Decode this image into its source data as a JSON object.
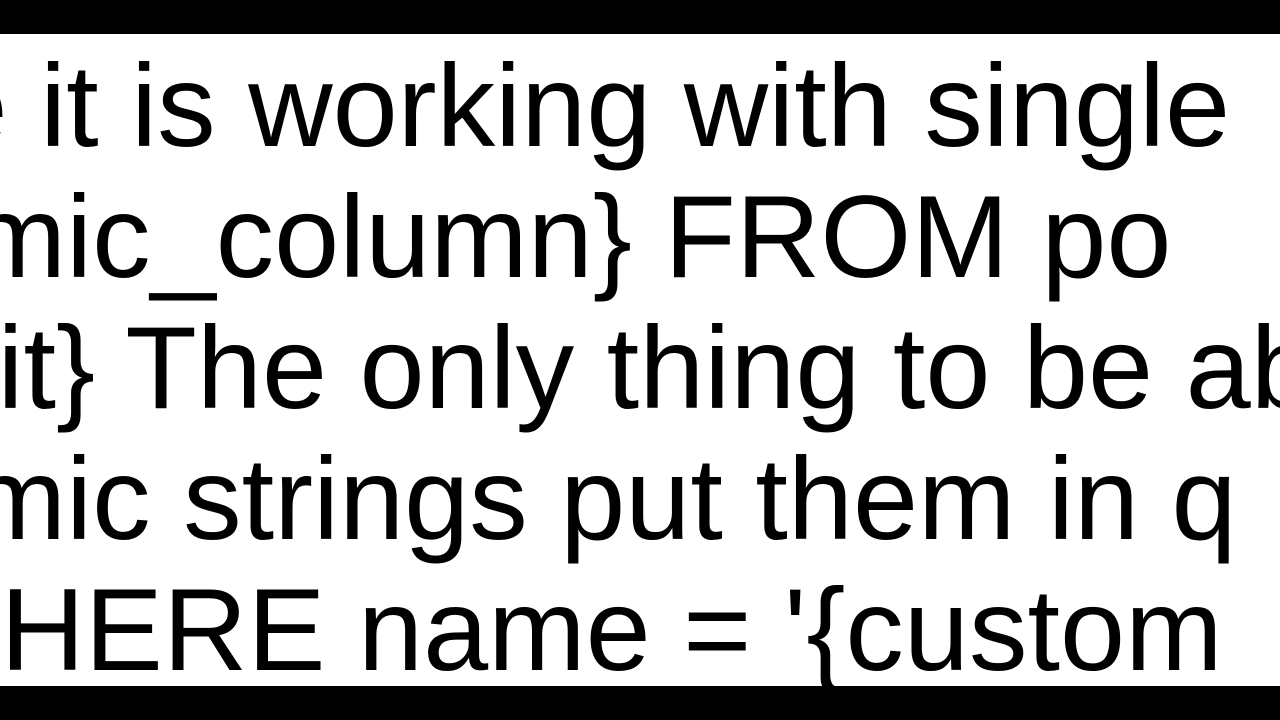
{
  "lines": {
    "l1": "ame it is working with single",
    "l2": "ynamic_column} FROM po",
    "l3": "mit}  The only thing to be ab",
    "l4": "ynamic strings put them in q",
    "l5": "WHERE name = '{custom_"
  }
}
